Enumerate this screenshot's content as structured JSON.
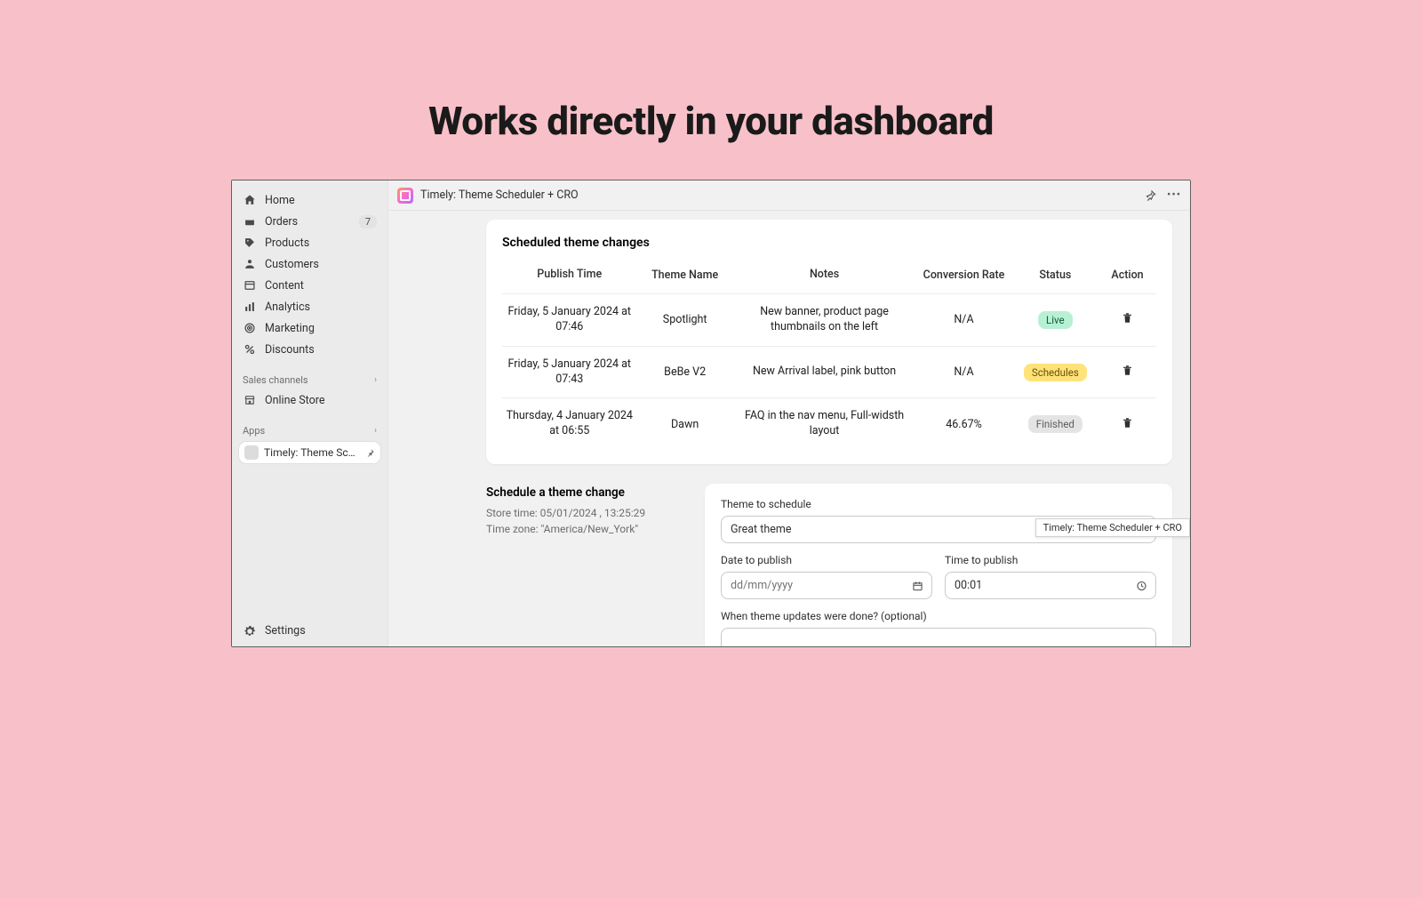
{
  "hero": {
    "title": "Works directly in your dashboard"
  },
  "sidebar": {
    "items": [
      {
        "label": "Home",
        "icon": "home-icon"
      },
      {
        "label": "Orders",
        "icon": "orders-icon",
        "badge": "7"
      },
      {
        "label": "Products",
        "icon": "products-icon"
      },
      {
        "label": "Customers",
        "icon": "customers-icon"
      },
      {
        "label": "Content",
        "icon": "content-icon"
      },
      {
        "label": "Analytics",
        "icon": "analytics-icon"
      },
      {
        "label": "Marketing",
        "icon": "marketing-icon"
      },
      {
        "label": "Discounts",
        "icon": "discounts-icon"
      }
    ],
    "channels_header": "Sales channels",
    "channels": [
      {
        "label": "Online Store",
        "icon": "store-icon"
      }
    ],
    "apps_header": "Apps",
    "active_app": "Timely: Theme Sched...",
    "settings": "Settings"
  },
  "topbar": {
    "app_title": "Timely: Theme Scheduler + CRO"
  },
  "card": {
    "title": "Scheduled theme changes",
    "columns": {
      "time": "Publish Time",
      "theme": "Theme Name",
      "notes": "Notes",
      "cr": "Conversion Rate",
      "status": "Status",
      "action": "Action"
    },
    "rows": [
      {
        "time": "Friday, 5 January 2024 at 07:46",
        "theme": "Spotlight",
        "notes": "New banner, product page thumbnails on the left",
        "cr": "N/A",
        "status": "Live",
        "status_kind": "live"
      },
      {
        "time": "Friday, 5 January 2024 at 07:43",
        "theme": "BeBe V2",
        "notes": "New Arrival label, pink button",
        "cr": "N/A",
        "status": "Schedules",
        "status_kind": "sched"
      },
      {
        "time": "Thursday, 4 January 2024 at 06:55",
        "theme": "Dawn",
        "notes": "FAQ in the nav menu, Full-widsth layout",
        "cr": "46.67%",
        "status": "Finished",
        "status_kind": "finished"
      }
    ]
  },
  "form": {
    "heading": "Schedule a theme change",
    "store_time": "Store time: 05/01/2024 , 13:25:29",
    "time_zone": "Time zone: \"America/New_York\"",
    "theme_label": "Theme to schedule",
    "theme_value": "Great theme",
    "date_label": "Date to publish",
    "date_placeholder": "dd/mm/yyyy",
    "time_label": "Time to publish",
    "time_value": "00:01",
    "notes_label": "When theme updates were done? (optional)"
  },
  "tooltip": "Timely: Theme Scheduler + CRO"
}
